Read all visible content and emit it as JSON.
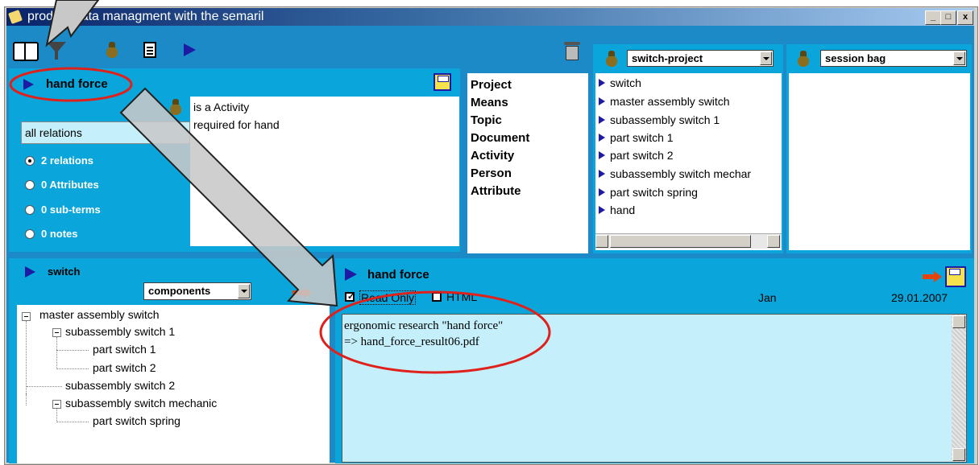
{
  "window": {
    "title": "product data managment with the semaril",
    "min": "_",
    "max": "□",
    "close": "x"
  },
  "toolbar": {
    "icons": [
      "book-icon",
      "filter-icon",
      "bag-icon",
      "document-icon",
      "play-icon"
    ],
    "trash_icon": "trash-icon"
  },
  "term": {
    "title": "hand force",
    "filter": "all relations",
    "counts": [
      "2 relations",
      "0 Attributes",
      "0 sub-terms",
      "0 notes"
    ],
    "selected_count": 0,
    "relations": [
      "is a Activity",
      "required for hand"
    ]
  },
  "categories": [
    "Project",
    "Means",
    "Topic",
    "Document",
    "Activity",
    "Person",
    "Attribute"
  ],
  "project": {
    "selected": "switch-project",
    "items": [
      "switch",
      "master assembly switch",
      "subassembly switch 1",
      "part switch 1",
      "part switch 2",
      "subassembly switch mechar",
      "part switch spring",
      "hand"
    ]
  },
  "session": {
    "selected": "session bag"
  },
  "component": {
    "title": "switch",
    "view": "components",
    "tree": [
      {
        "label": "master assembly switch",
        "level": 0,
        "expander": "minus"
      },
      {
        "label": "subassembly switch 1",
        "level": 1,
        "expander": "minus"
      },
      {
        "label": "part switch 1",
        "level": 2,
        "expander": ""
      },
      {
        "label": "part switch 2",
        "level": 2,
        "expander": ""
      },
      {
        "label": "subassembly switch 2",
        "level": 1,
        "expander": ""
      },
      {
        "label": "subassembly switch mechanic",
        "level": 1,
        "expander": "minus"
      },
      {
        "label": "part switch spring",
        "level": 2,
        "expander": ""
      }
    ]
  },
  "note": {
    "title": "hand force",
    "readonly_label": "Read Only",
    "readonly_checked": true,
    "html_label": "HTML",
    "html_checked": false,
    "author": "Jan",
    "date": "29.01.2007",
    "text_line1": "ergonomic research \"hand force\"",
    "text_line2": "=> hand_force_result06.pdf"
  },
  "colors": {
    "panel": "#0aa6db",
    "client": "#1b8ac6",
    "accent": "#1d1aa3",
    "annotation": "#e0201b",
    "note_bg": "#c5f0fb"
  }
}
